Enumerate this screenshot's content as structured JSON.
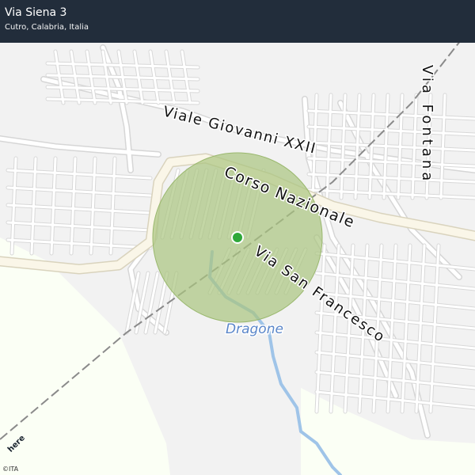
{
  "header": {
    "title": "Via Siena 3",
    "subtitle": "Cutro, Calabria, Italia"
  },
  "map": {
    "street_labels": [
      "Viale Giovanni XXII",
      "Corso Nazionale",
      "Via San Francesco",
      "Via Fontana"
    ],
    "water_label": "Dragone",
    "colors": {
      "background": "#f2f2f2",
      "countryside": "#fbfff5",
      "road": "#ffffff",
      "road_edge": "#d6d6d6",
      "main_road": "#faf6e8",
      "accuracy_circle": "#a9c47f",
      "marker": "#2fa83a",
      "river": "#9fc4e8",
      "railway": "#8a8a8a",
      "header": "#222d3b"
    }
  },
  "attribution": {
    "copyright": "©ITA",
    "provider_logo": "here"
  }
}
